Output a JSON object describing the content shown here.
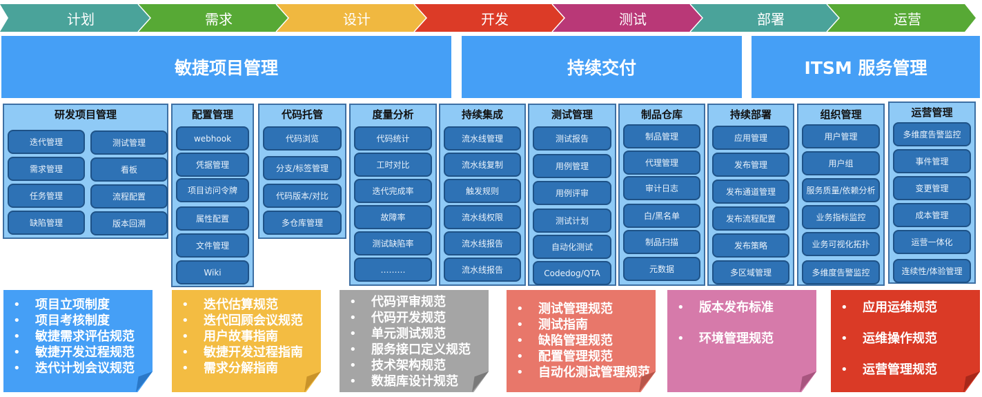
{
  "stages": [
    {
      "label": "计划",
      "color": "#4aa39a"
    },
    {
      "label": "需求",
      "color": "#57a935"
    },
    {
      "label": "设计",
      "color": "#f0b840"
    },
    {
      "label": "开发",
      "color": "#dc3b27"
    },
    {
      "label": "测试",
      "color": "#b93877"
    },
    {
      "label": "部署",
      "color": "#4aa39a"
    },
    {
      "label": "运营",
      "color": "#57a935"
    }
  ],
  "sections": [
    {
      "label": "敏捷项目管理"
    },
    {
      "label": "持续交付"
    },
    {
      "label": "ITSM 服务管理"
    }
  ],
  "modules": [
    {
      "title": "研发项目管理",
      "items": [
        "迭代管理",
        "测试管理",
        "需求管理",
        "看板",
        "任务管理",
        "流程配置",
        "缺陷管理",
        "版本回溯"
      ]
    },
    {
      "title": "配置管理",
      "items": [
        "webhook",
        "凭据管理",
        "项目访问令牌",
        "属性配置",
        "文件管理",
        "Wiki"
      ]
    },
    {
      "title": "代码托管",
      "items": [
        "代码浏览",
        "分支/标签管理",
        "代码版本/对比",
        "多仓库管理"
      ]
    },
    {
      "title": "度量分析",
      "items": [
        "代码统计",
        "工时对比",
        "迭代完成率",
        "故障率",
        "测试缺陷率",
        "………"
      ]
    },
    {
      "title": "持续集成",
      "items": [
        "流水线管理",
        "流水线复制",
        "触发规则",
        "流水线权限",
        "流水线报告",
        "流水线报告"
      ]
    },
    {
      "title": "测试管理",
      "items": [
        "测试报告",
        "用例管理",
        "用例评审",
        "测试计划",
        "自动化测试",
        "Codedog/QTA"
      ]
    },
    {
      "title": "制品仓库",
      "items": [
        "制品管理",
        "代理管理",
        "审计日志",
        "白/黑名单",
        "制品扫描",
        "元数据"
      ]
    },
    {
      "title": "持续部署",
      "items": [
        "应用管理",
        "发布管理",
        "发布通道管理",
        "发布流程配置",
        "发布策略",
        "多区域管理"
      ]
    },
    {
      "title": "组织管理",
      "items": [
        "用户管理",
        "用户组",
        "服务质量/依赖分析",
        "业务指标监控",
        "业务可视化拓扑",
        "多维度告警监控"
      ]
    },
    {
      "title": "运营管理",
      "items": [
        "多维度告警监控",
        "事件管理",
        "变更管理",
        "成本管理",
        "运营一体化",
        "连续性/体验管理"
      ]
    }
  ],
  "notes": [
    {
      "color": "#459ff6",
      "fold": "#2a78c8",
      "bullet": "•",
      "items": [
        "项目立项制度",
        "项目考核制度",
        "敏捷需求评估规范",
        "敏捷开发过程规范",
        "迭代计划会议规范"
      ]
    },
    {
      "color": "#f3bc42",
      "fold": "#c9932a",
      "bullet": "•",
      "items": [
        "迭代估算规范",
        "迭代回顾会议规范",
        "用户故事指南",
        "敏捷开发过程指南",
        "需求分解指南"
      ]
    },
    {
      "color": "#a5a5a5",
      "fold": "#7a7a7a",
      "bullet": "•",
      "items": [
        "代码评审规范",
        "代码开发规范",
        "单元测试规范",
        "服务接口定义规范",
        "技术架构规范",
        "数据库设计规范"
      ]
    },
    {
      "color": "#e8776a",
      "fold": "#b8554a",
      "bullet": "•",
      "items": [
        "测试管理规范",
        "测试指南",
        "缺陷管理规范",
        "配置管理规范",
        "自动化测试管理规范"
      ]
    },
    {
      "color": "#d67aaa",
      "fold": "#a8557f",
      "bullet": "•",
      "items": [
        "版本发布标准",
        "环境管理规范"
      ]
    },
    {
      "color": "#da3a26",
      "fold": "#a8281a",
      "bullet": "•",
      "items": [
        "应用运维规范",
        "运维操作规范",
        "运营管理规范"
      ]
    }
  ]
}
